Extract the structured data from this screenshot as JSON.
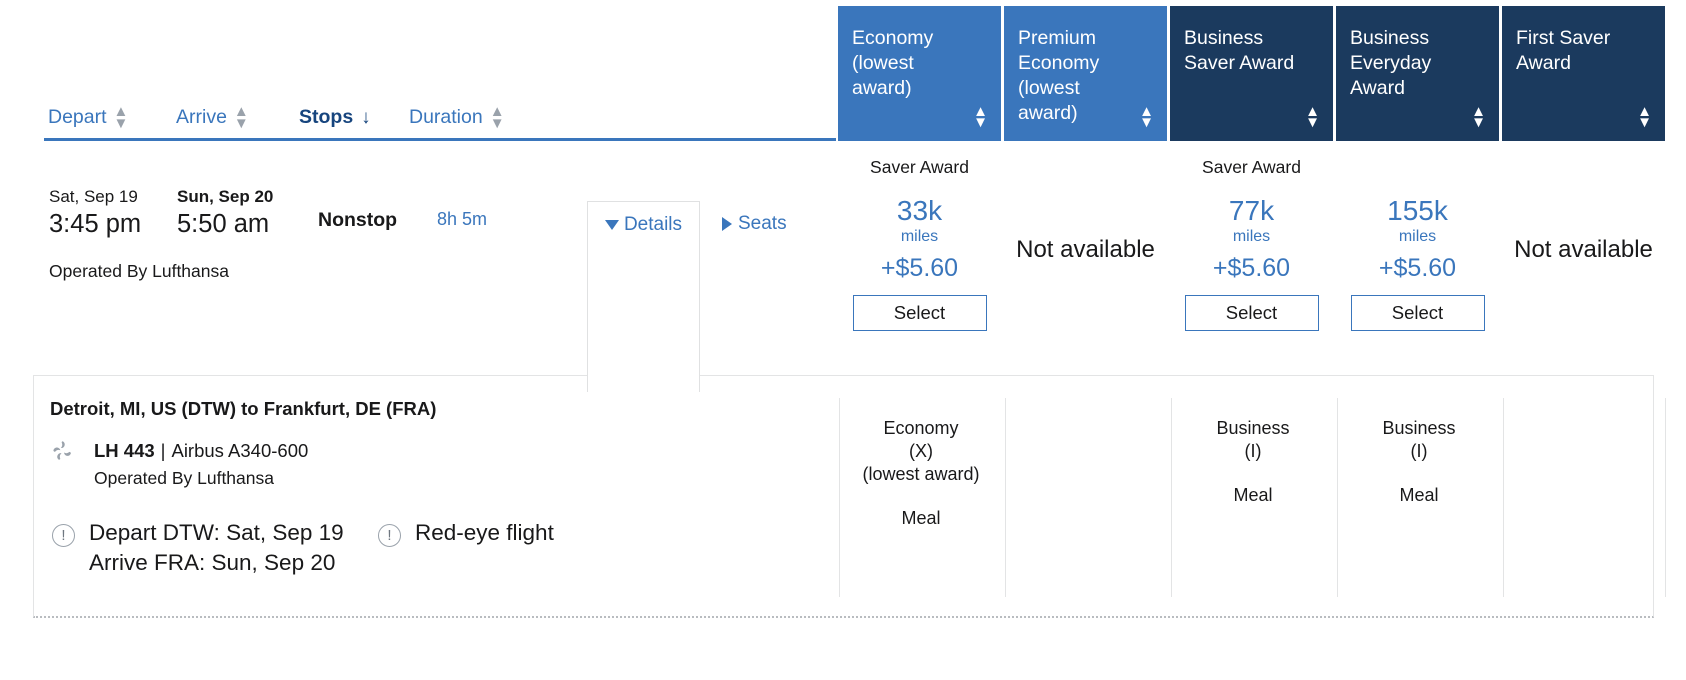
{
  "sort_bar": {
    "items": [
      {
        "label": "Depart",
        "indicator": "updown",
        "active": false
      },
      {
        "label": "Arrive",
        "indicator": "updown",
        "active": false
      },
      {
        "label": "Stops",
        "indicator": "down",
        "active": true
      },
      {
        "label": "Duration",
        "indicator": "updown",
        "active": false
      }
    ]
  },
  "fare_columns": [
    {
      "header": "Economy\n(lowest\naward)",
      "tone": "light"
    },
    {
      "header": "Premium\nEconomy\n(lowest\naward)",
      "tone": "light"
    },
    {
      "header": "Business\nSaver Award",
      "tone": "dark"
    },
    {
      "header": "Business\nEveryday\nAward",
      "tone": "dark"
    },
    {
      "header": "First Saver\nAward",
      "tone": "dark"
    }
  ],
  "flight": {
    "depart_date": "Sat, Sep 19",
    "depart_time": "3:45 pm",
    "arrive_date": "Sun, Sep 20",
    "arrive_time": "5:50 am",
    "stops": "Nonstop",
    "duration": "8h 5m",
    "operated_by": "Operated By Lufthansa",
    "details_label": "Details",
    "seats_label": "Seats"
  },
  "fares": [
    {
      "award_label": "Saver Award",
      "miles": "33k",
      "miles_unit": "miles",
      "cash": "+$5.60",
      "select_label": "Select",
      "available": true
    },
    {
      "unavailable_text": "Not available",
      "available": false
    },
    {
      "award_label": "Saver Award",
      "miles": "77k",
      "miles_unit": "miles",
      "cash": "+$5.60",
      "select_label": "Select",
      "available": true
    },
    {
      "award_label": "",
      "miles": "155k",
      "miles_unit": "miles",
      "cash": "+$5.60",
      "select_label": "Select",
      "available": true
    },
    {
      "unavailable_text": "Not available",
      "available": false
    }
  ],
  "details_panel": {
    "route": "Detroit, MI, US (DTW) to Frankfurt, DE (FRA)",
    "flight_number": "LH 443",
    "separator": "|",
    "aircraft": "Airbus A340-600",
    "operated_by": "Operated By Lufthansa",
    "alerts": [
      {
        "line1": "Depart DTW: Sat, Sep 19",
        "line2": "Arrive FRA: Sun, Sep 20"
      },
      {
        "line1": "Red-eye flight",
        "line2": ""
      }
    ],
    "cabins": [
      {
        "line1": "Economy",
        "line2": "(X)",
        "line3": "(lowest award)",
        "meal": "Meal"
      },
      {
        "line1": "",
        "line2": "",
        "line3": "",
        "meal": ""
      },
      {
        "line1": "Business",
        "line2": "(I)",
        "line3": "",
        "meal": "Meal"
      },
      {
        "line1": "Business",
        "line2": "(I)",
        "line3": "",
        "meal": "Meal"
      },
      {
        "line1": "",
        "line2": "",
        "line3": "",
        "meal": ""
      }
    ]
  },
  "colors": {
    "header_light": "#3a76bc",
    "header_dark": "#1b3a5e",
    "link_blue": "#3a76bc",
    "text_dark": "#19191a"
  }
}
